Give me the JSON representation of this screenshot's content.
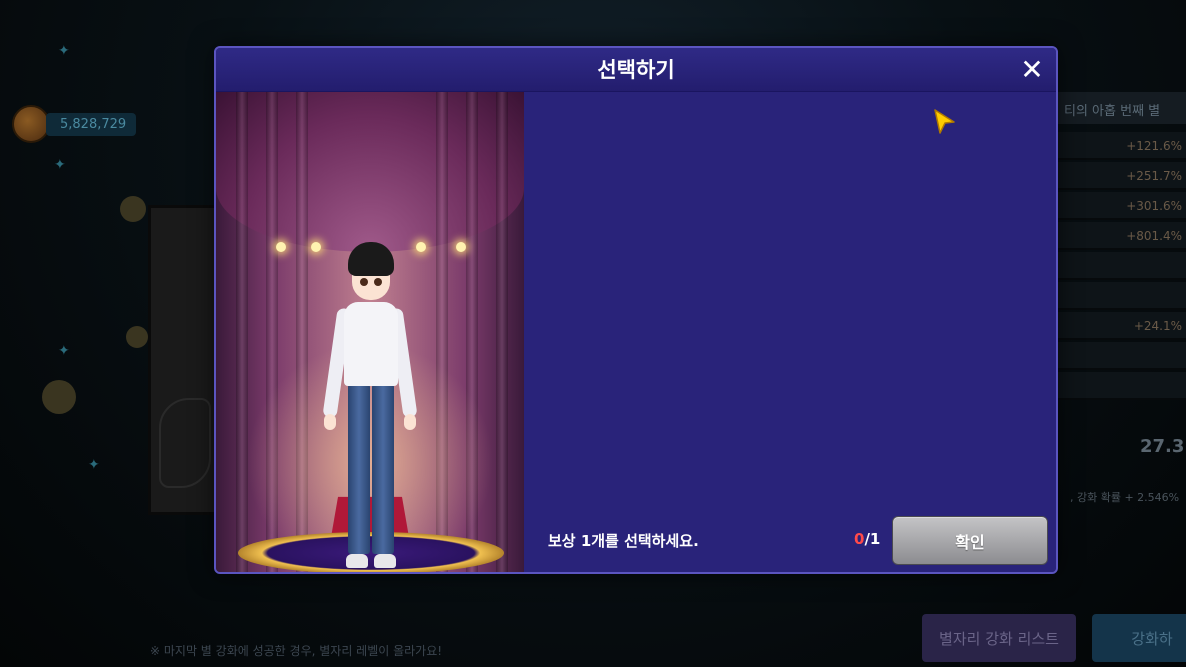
{
  "background": {
    "currency": {
      "icon": "currency-coin-icon",
      "value": "5,828,729"
    },
    "side_panel": {
      "title": "티의 아홉 번째 별",
      "rows": [
        "+121.6%",
        "+251.7%",
        "+301.6%",
        "+801.4%",
        "",
        "",
        "+24.1%",
        "",
        ""
      ],
      "total_value": "27.3",
      "rate_text": ", 강화 확률 + 2.546%"
    },
    "footer_note": "※ 마지막 별 강화에 성공한 경우, 별자리 레벨이 올라가요!",
    "list_button": "별자리 강화 리스트",
    "enhance_button": "강화하"
  },
  "modal": {
    "title": "선택하기",
    "close_icon": "close-icon",
    "prompt": "보상 1개를 선택하세요.",
    "selected_count": "0",
    "count_separator": "/",
    "max_count": "1",
    "confirm_button": "확인",
    "colors": {
      "modal_bg": "#29237a",
      "header_bg": "#2f2a86",
      "count_highlight": "#ff4a4a",
      "button": "#a8a8aa"
    }
  }
}
